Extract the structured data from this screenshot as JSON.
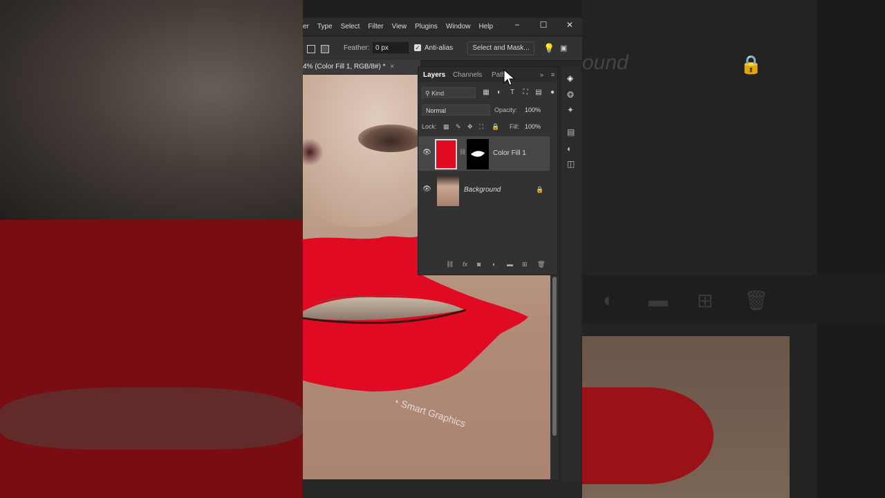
{
  "menu": {
    "items": [
      "er",
      "Type",
      "Select",
      "Filter",
      "View",
      "Plugins",
      "Window",
      "Help"
    ]
  },
  "window_controls": {
    "minimize": "−",
    "maximize": "☐",
    "close": "✕"
  },
  "options_bar": {
    "feather_label": "Feather:",
    "feather_value": "0 px",
    "antialias_label": "Anti-alias",
    "antialias_checked": true,
    "select_mask_label": "Select and Mask..."
  },
  "document_tab": {
    "title": "4% (Color Fill 1, RGB/8#) *",
    "close": "×"
  },
  "watermark": {
    "text": "Smart Graphics"
  },
  "layers_panel": {
    "tabs": [
      "Layers",
      "Channels",
      "Path"
    ],
    "active_tab": "Layers",
    "filter_kind": "Kind",
    "blend_mode": "Normal",
    "opacity_label": "Opacity:",
    "opacity_value": "100%",
    "lock_label": "Lock:",
    "fill_label": "Fill:",
    "fill_value": "100%",
    "layers": [
      {
        "name": "Color Fill 1",
        "visible": true,
        "selected": true,
        "fill_color": "#e00b23"
      },
      {
        "name": "Background",
        "visible": true,
        "selected": false,
        "locked": true
      }
    ],
    "footer_fx": "fx"
  },
  "background_blur": {
    "layer_text": "ound"
  },
  "colors": {
    "lip_red": "#e00b23",
    "panel": "#323232",
    "selected_layer": "#464646"
  }
}
